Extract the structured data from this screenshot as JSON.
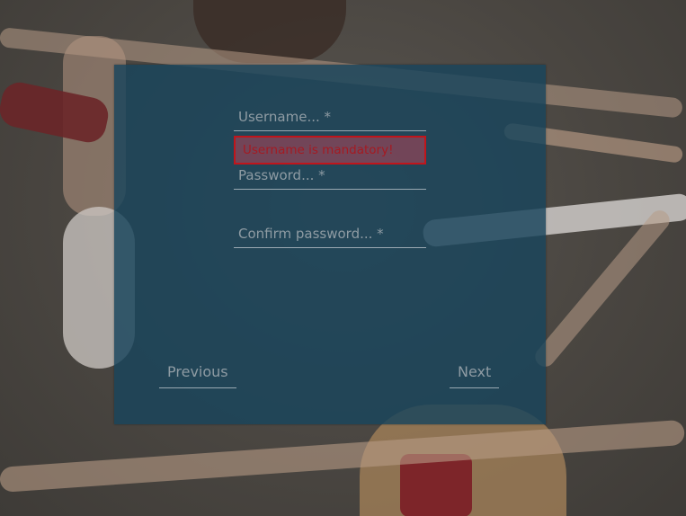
{
  "form": {
    "username_placeholder": "Username... *",
    "password_placeholder": "Password... *",
    "confirm_placeholder": "Confirm password... *",
    "username_error": "Username is mandatory!"
  },
  "navigation": {
    "previous_label": "Previous",
    "next_label": "Next"
  },
  "colors": {
    "panel": "#18445c",
    "error_border": "#c0151b",
    "error_text": "#a51a22"
  }
}
